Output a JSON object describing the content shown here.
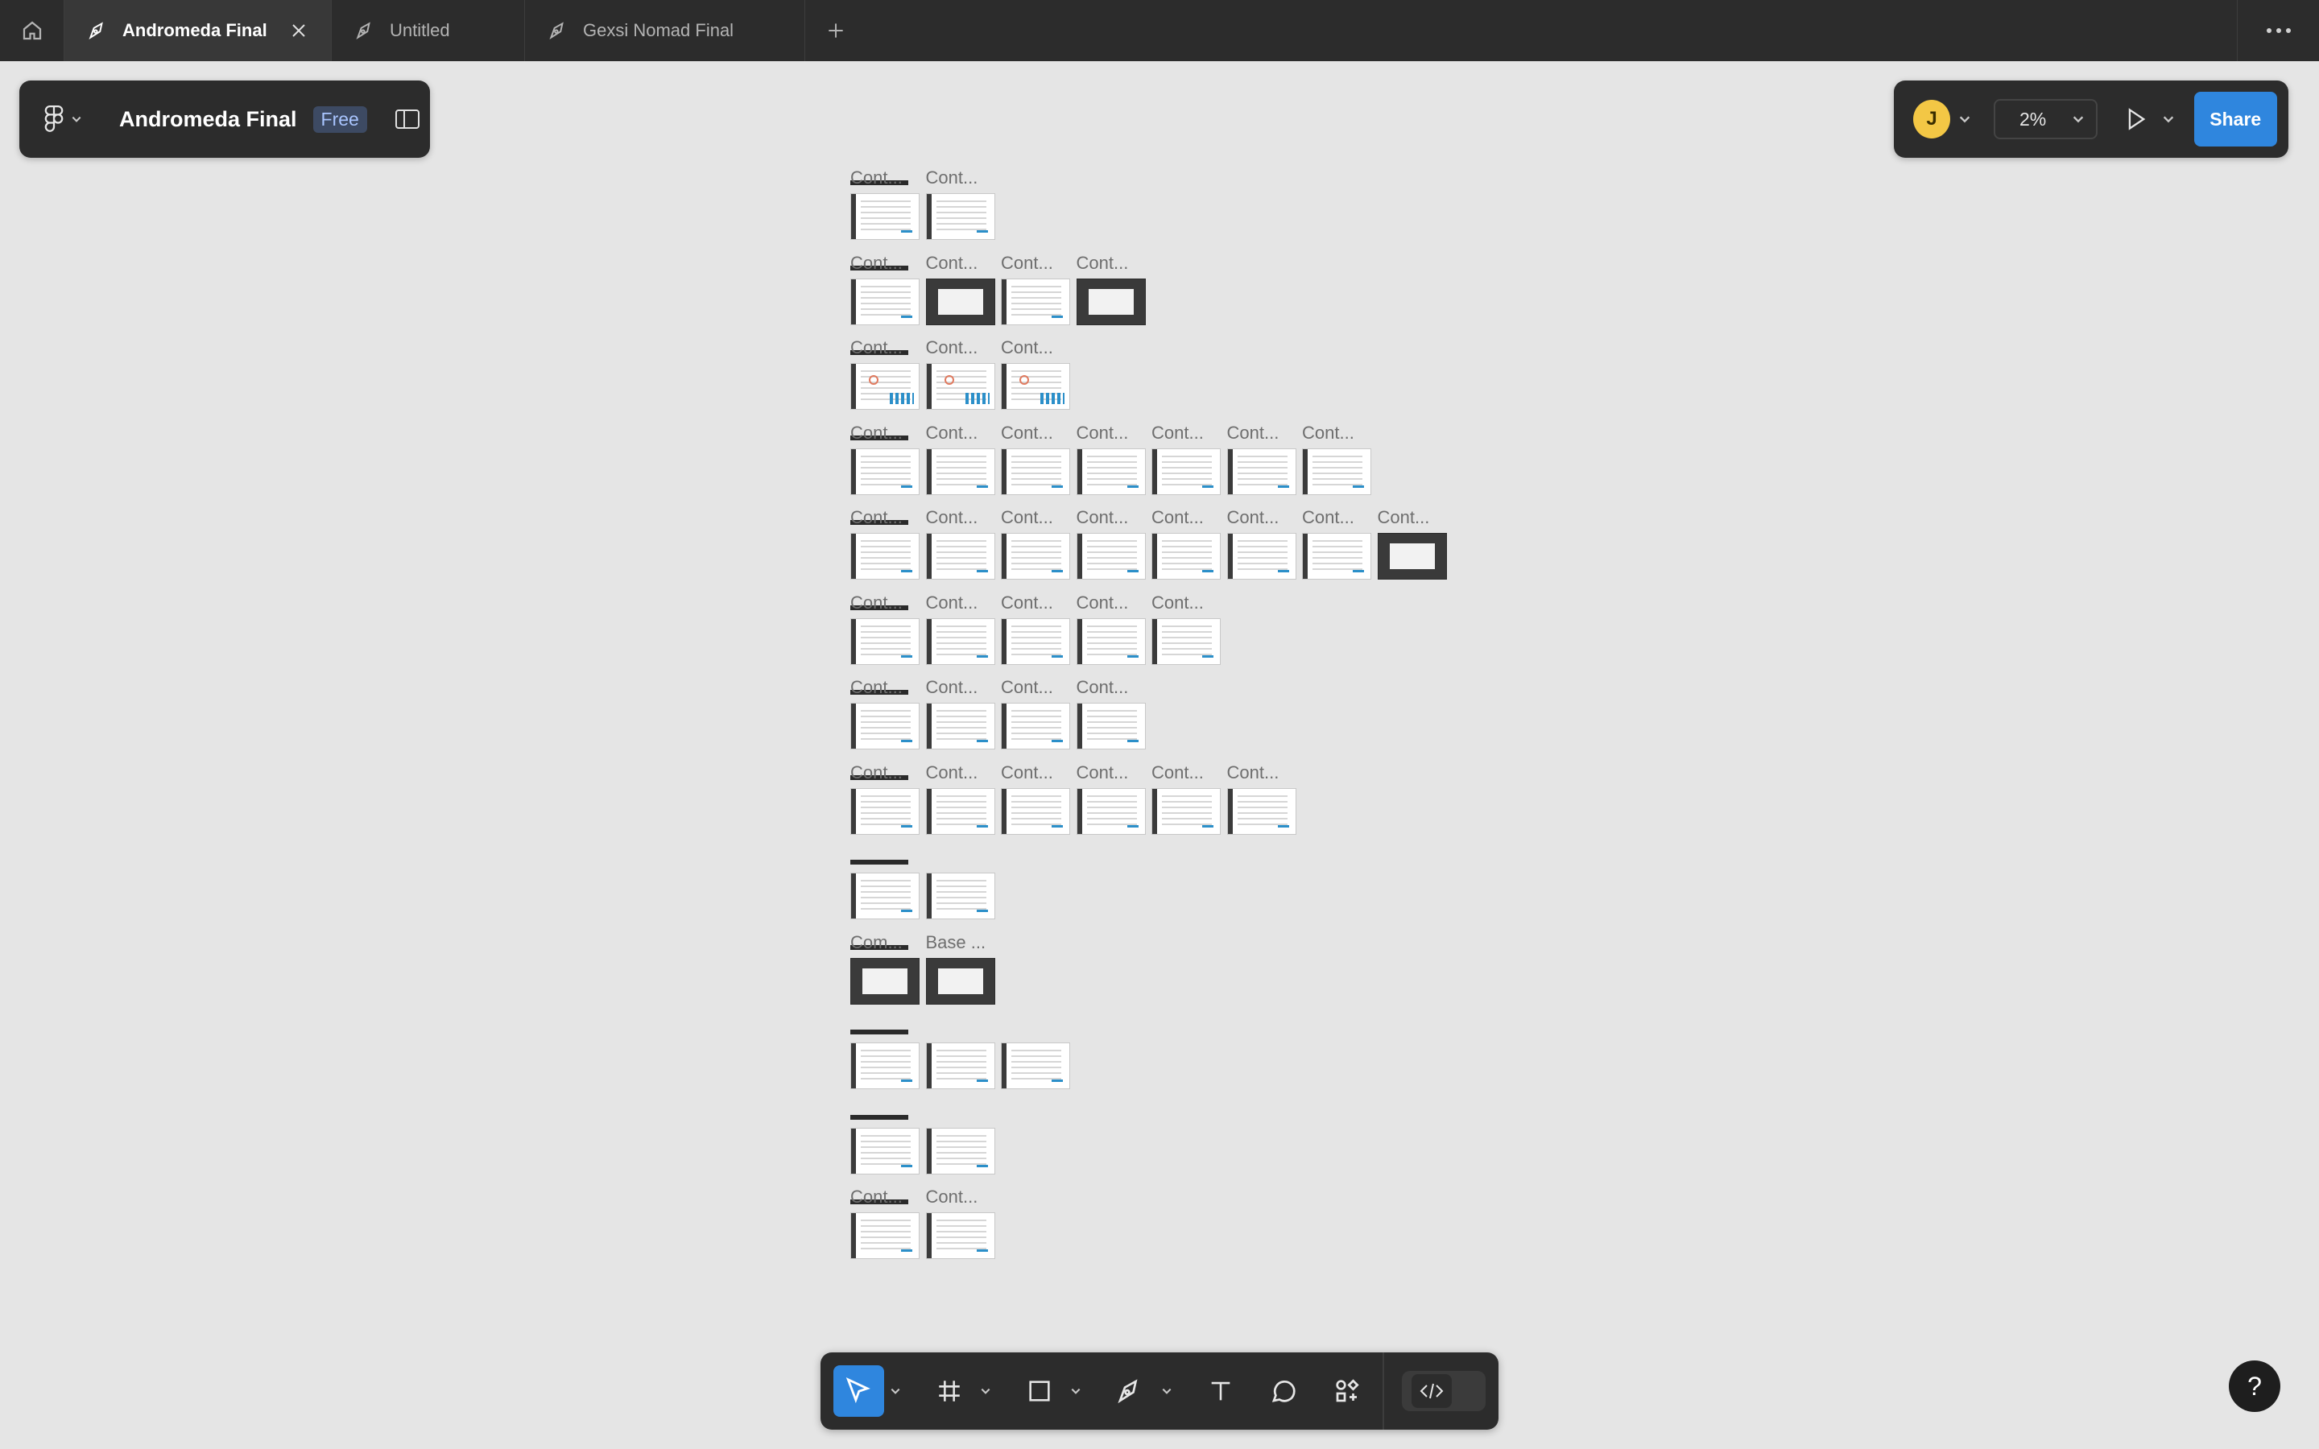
{
  "tabs": [
    {
      "title": "Andromeda Final",
      "active": true,
      "closable": true,
      "icon": "design-file-icon"
    },
    {
      "title": "Untitled",
      "active": false,
      "icon": "design-file-icon"
    },
    {
      "title": "Gexsi Nomad Final",
      "active": false,
      "icon": "design-file-icon"
    }
  ],
  "file": {
    "name": "Andromeda Final",
    "plan": "Free"
  },
  "zoom": "2%",
  "avatar_initial": "J",
  "share_label": "Share",
  "help_label": "?",
  "colors": {
    "accent": "#2f86de",
    "avatar": "#f3c745",
    "chrome": "#2c2c2c",
    "canvas": "#e5e5e5"
  },
  "sections": [
    {
      "labels": [
        "Cont...",
        "Cont..."
      ],
      "thumbs": [
        "grid",
        "grid"
      ]
    },
    {
      "labels": [
        "Cont...",
        "Cont...",
        "Cont...",
        "Cont..."
      ],
      "thumbs": [
        "doc",
        "dark",
        "doc",
        "dark"
      ]
    },
    {
      "labels": [
        "Cont...",
        "Cont...",
        "Cont..."
      ],
      "thumbs": [
        "chart",
        "chart",
        "chart"
      ]
    },
    {
      "labels": [
        "Cont...",
        "Cont...",
        "Cont...",
        "Cont...",
        "Cont...",
        "Cont...",
        "Cont..."
      ],
      "thumbs": [
        "grid",
        "grid",
        "grid",
        "doc",
        "doc",
        "doc",
        "doc"
      ]
    },
    {
      "labels": [
        "Cont...",
        "Cont...",
        "Cont...",
        "Cont...",
        "Cont...",
        "Cont...",
        "Cont...",
        "Cont..."
      ],
      "thumbs": [
        "doc",
        "doc",
        "doc",
        "doc",
        "doc",
        "doc",
        "doc",
        "dark"
      ]
    },
    {
      "labels": [
        "Cont...",
        "Cont...",
        "Cont...",
        "Cont...",
        "Cont..."
      ],
      "thumbs": [
        "doc",
        "doc",
        "doc",
        "doc",
        "doc"
      ]
    },
    {
      "labels": [
        "Cont...",
        "Cont...",
        "Cont...",
        "Cont..."
      ],
      "thumbs": [
        "doc",
        "doc",
        "doc",
        "doc"
      ]
    },
    {
      "labels": [
        "Cont...",
        "Cont...",
        "Cont...",
        "Cont...",
        "Cont...",
        "Cont..."
      ],
      "thumbs": [
        "doc",
        "doc",
        "doc",
        "doc",
        "doc",
        "doc"
      ]
    },
    {
      "labels": [
        "",
        ""
      ],
      "thumbs": [
        "doc",
        "doc"
      ]
    },
    {
      "labels": [
        "Com...",
        "Base ..."
      ],
      "thumbs": [
        "dark",
        "dark"
      ]
    },
    {
      "labels": [
        "",
        "",
        ""
      ],
      "thumbs": [
        "doc",
        "doc",
        "doc"
      ]
    },
    {
      "labels": [
        "",
        ""
      ],
      "thumbs": [
        "doc",
        "doc"
      ]
    },
    {
      "labels": [
        "Cont...",
        "Cont..."
      ],
      "thumbs": [
        "doc",
        "doc"
      ]
    }
  ],
  "toolbar": {
    "tools": [
      "move-tool",
      "frame-tool",
      "rectangle-tool",
      "pen-tool",
      "text-tool",
      "comment-tool",
      "actions-tool"
    ],
    "active_tool": "move-tool",
    "dev_mode": "off"
  }
}
